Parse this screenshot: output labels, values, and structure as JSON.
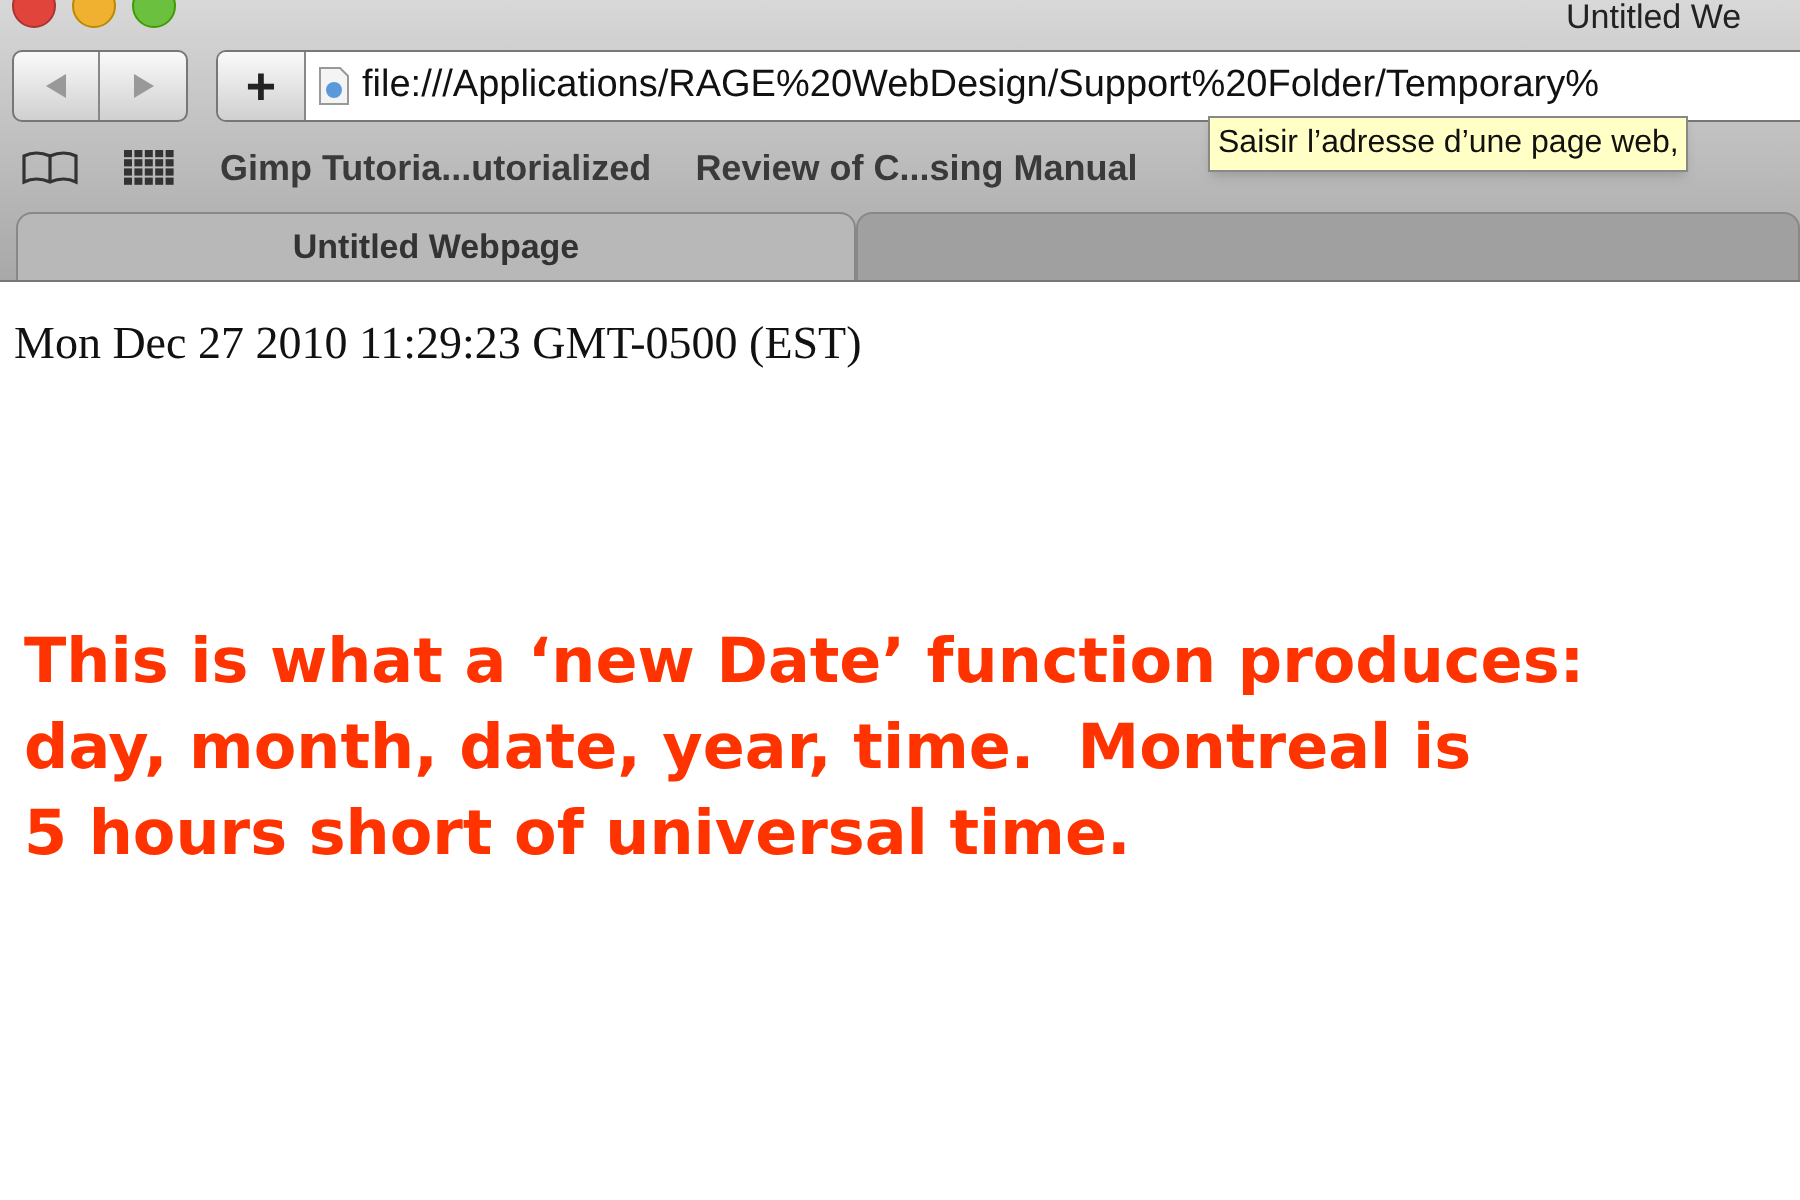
{
  "window": {
    "title": "Untitled We"
  },
  "toolbar": {
    "back_disabled": true,
    "forward_disabled": true,
    "add_button": "+",
    "address": "file:///Applications/RAGE%20WebDesign/Support%20Folder/Temporary%"
  },
  "tooltip": "Saisir l’adresse d’une page web,",
  "bookmarks": [
    "Gimp Tutoria...utorialized",
    "Review of C...sing Manual"
  ],
  "tabs": [
    {
      "label": "Untitled Webpage",
      "selected": true
    },
    {
      "selected": false
    }
  ],
  "page": {
    "date_line": "Mon Dec 27 2010 11:29:23 GMT-0500 (EST)",
    "note_lines": [
      "This is what a ‘new Date’ function produces:",
      "day, month, date, year, time.  Montreal is",
      "5 hours short of universal time."
    ]
  }
}
